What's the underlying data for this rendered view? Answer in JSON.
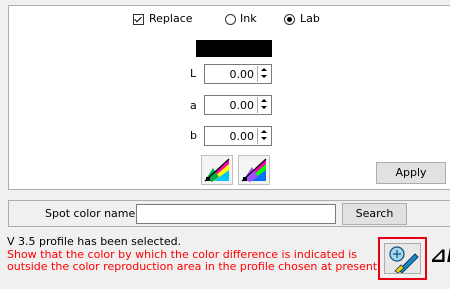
{
  "options": {
    "replace_label": "Replace",
    "replace_checked": true,
    "ink_label": "Ink",
    "lab_label": "Lab",
    "selected_mode": "Lab"
  },
  "color_preview": {
    "color": "#000000"
  },
  "lab_fields": [
    {
      "label": "L",
      "value": "0.00"
    },
    {
      "label": "a",
      "value": "0.00"
    },
    {
      "label": "b",
      "value": "0.00"
    }
  ],
  "buttons": {
    "apply_label": "Apply",
    "search_label": "Search",
    "gamut_icon_1": "color-gamut-icon",
    "gamut_icon_2": "color-gamut-icon",
    "gamut_warning_icon": "gamut-warning-icon"
  },
  "search": {
    "label": "Spot color name",
    "value": ""
  },
  "status": {
    "profile_text": "V 3.5 profile has been selected.",
    "warning_line1": "Show that the color by which the color difference is indicated is",
    "warning_line2": "outside the color reproduction area in the profile chosen at present."
  },
  "delta_label": "⊿E",
  "colors": {
    "warning_text": "#ff0000",
    "highlight_border": "#e60012"
  }
}
